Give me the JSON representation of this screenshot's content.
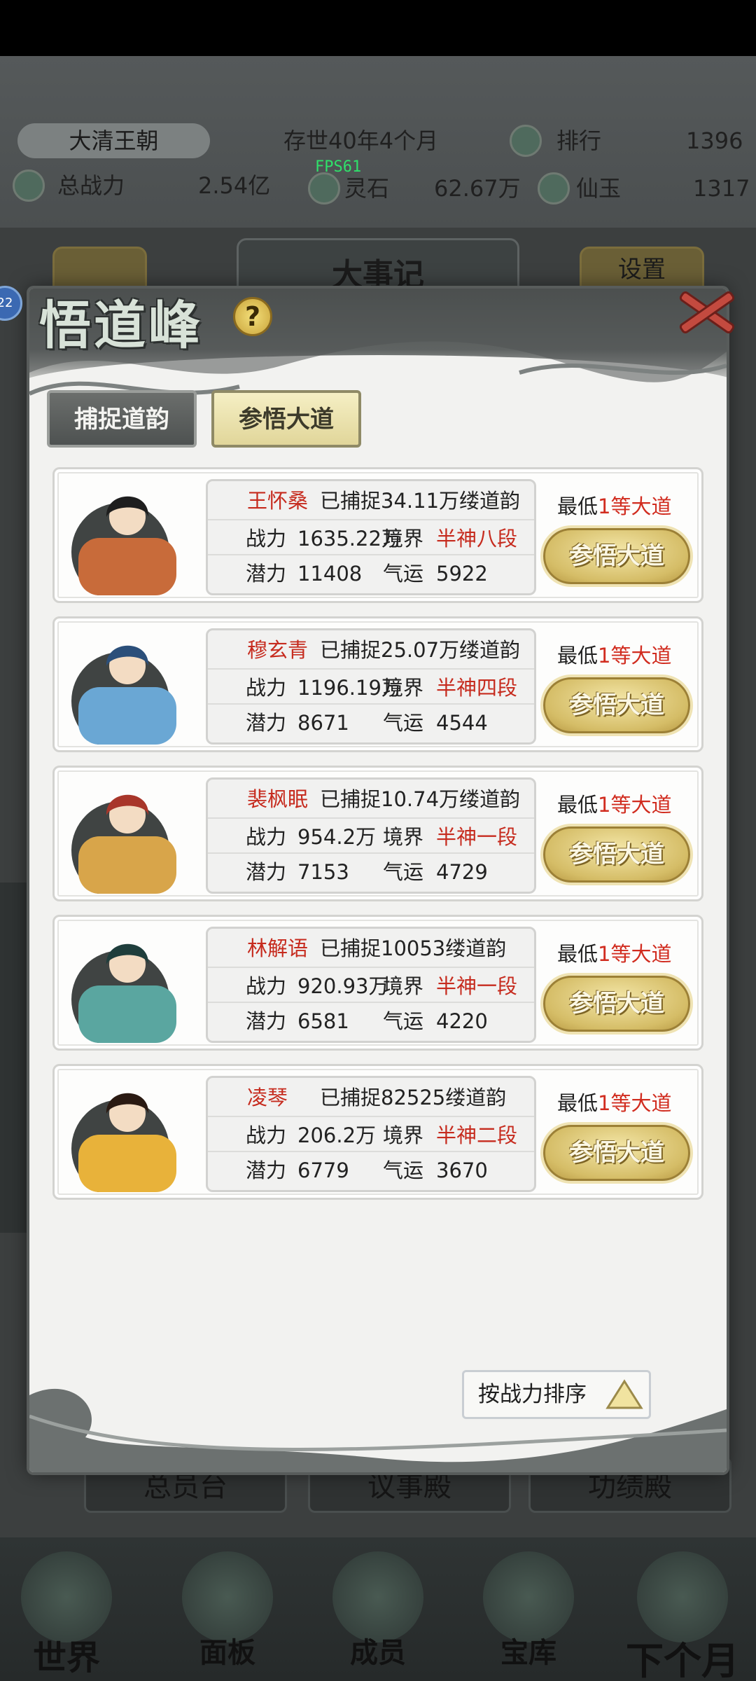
{
  "hud": {
    "dynasty": "大清王朝",
    "age": "存世40年4个月",
    "rank_label": "排行",
    "rank_value": "1396",
    "power_label": "总战力",
    "power_value": "2.54亿",
    "fps": "FPS61",
    "stone_label": "灵石",
    "stone_value": "62.67万",
    "jade_label": "仙玉",
    "jade_value": "1317"
  },
  "background": {
    "center_title": "大事记",
    "settings": "设置",
    "buttons": [
      "总员台",
      "议事殿",
      "功绩殿"
    ],
    "nav": [
      "世界",
      "面板",
      "成员",
      "宝库",
      "下个月"
    ],
    "side_badge": "22"
  },
  "modal": {
    "title": "悟道峰",
    "help": "?",
    "tabs": [
      "捕捉道韵",
      "参悟大道"
    ],
    "sort_label": "按战力排序",
    "labels": {
      "power": "战力",
      "realm": "境界",
      "potential": "潜力",
      "luck": "气运",
      "min_prefix": "最低",
      "min_level": "1等大道",
      "action": "参悟大道"
    },
    "entries": [
      {
        "name": "王怀桑",
        "caught": "已捕捉34.11万缕道韵",
        "power": "1635.22万",
        "realm": "半神八段",
        "potential": "11408",
        "luck": "5922"
      },
      {
        "name": "穆玄青",
        "caught": "已捕捉25.07万缕道韵",
        "power": "1196.19万",
        "realm": "半神四段",
        "potential": "8671",
        "luck": "4544"
      },
      {
        "name": "裴枫眠",
        "caught": "已捕捉10.74万缕道韵",
        "power": "954.2万",
        "realm": "半神一段",
        "potential": "7153",
        "luck": "4729"
      },
      {
        "name": "林解语",
        "caught": "已捕捉10053缕道韵",
        "power": "920.93万",
        "realm": "半神一段",
        "potential": "6581",
        "luck": "4220"
      },
      {
        "name": "凌琴",
        "caught": "已捕捉82525缕道韵",
        "power": "206.2万",
        "realm": "半神二段",
        "potential": "6779",
        "luck": "3670"
      }
    ]
  },
  "colors": {
    "accent_red": "#c62b1e",
    "gold_button": "#d5bd67",
    "tab_active": "#e1d69a"
  }
}
